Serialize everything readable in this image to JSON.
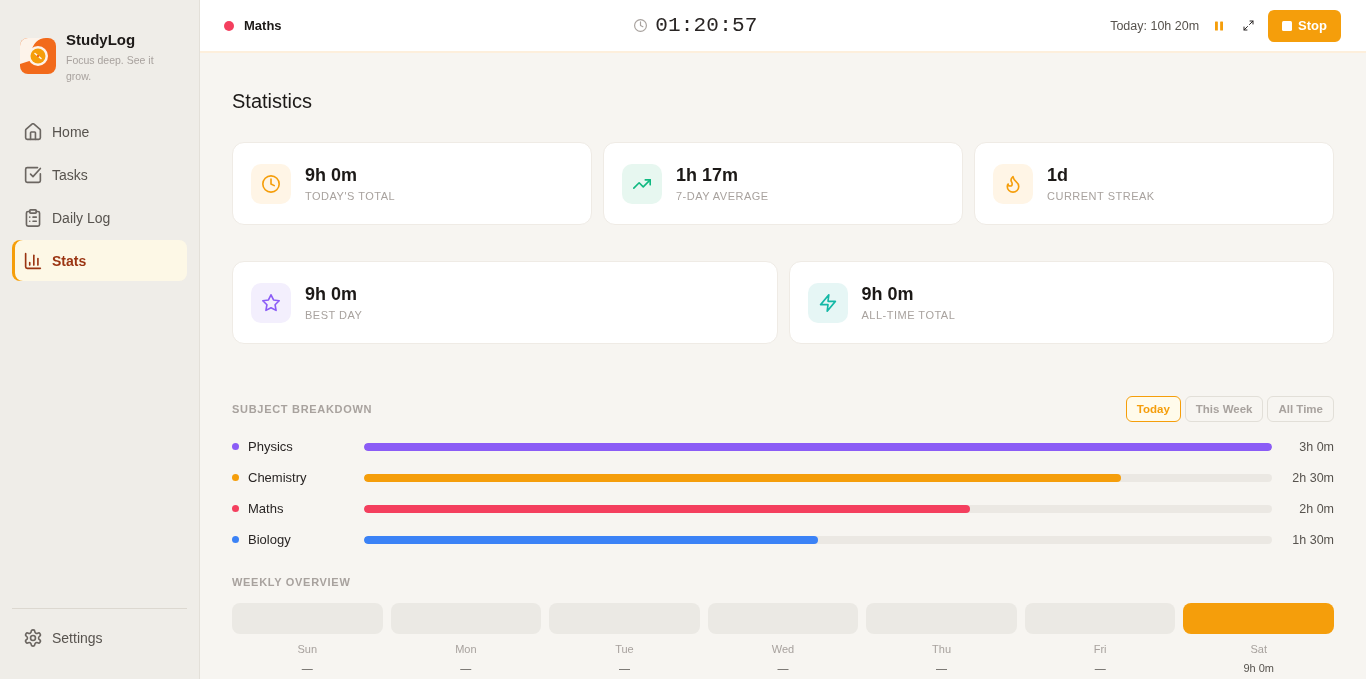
{
  "sidebar": {
    "brand": {
      "name": "StudyLog",
      "tagline": "Focus deep. See it grow."
    },
    "nav": [
      {
        "label": "Home",
        "kind": "home",
        "selected": false
      },
      {
        "label": "Tasks",
        "kind": "tasks",
        "selected": false
      },
      {
        "label": "Daily Log",
        "kind": "log",
        "selected": false
      },
      {
        "label": "Stats",
        "kind": "stats",
        "selected": true
      }
    ],
    "footer_nav": [
      {
        "label": "Settings",
        "kind": "settings",
        "selected": false
      }
    ]
  },
  "top_bar": {
    "subject": {
      "name": "Maths",
      "color": "#f43f5e"
    },
    "timer": "01:20:57",
    "today_total": "Today: 10h 20m",
    "controls": [
      {
        "kind": "pause"
      },
      {
        "kind": "expand"
      },
      {
        "kind": "stop",
        "label": "Stop"
      }
    ]
  },
  "page": {
    "title": "Statistics"
  },
  "stat_rows": [
    {
      "cards": [
        {
          "kind": "today",
          "value": "9h 0m",
          "label": "TODAY'S TOTAL"
        },
        {
          "kind": "average",
          "value": "1h 17m",
          "label": "7-DAY AVERAGE"
        },
        {
          "kind": "streak",
          "value": "1d",
          "label": "CURRENT STREAK"
        }
      ]
    },
    {
      "cards": [
        {
          "kind": "best",
          "value": "9h 0m",
          "label": "BEST DAY"
        },
        {
          "kind": "total",
          "value": "9h 0m",
          "label": "ALL-TIME TOTAL"
        }
      ]
    }
  ],
  "subject_breakdown": {
    "title": "SUBJECT BREAKDOWN",
    "periods": [
      {
        "label": "Today",
        "selected": true
      },
      {
        "label": "This Week",
        "selected": false
      },
      {
        "label": "All Time",
        "selected": false
      }
    ],
    "subjects": [
      {
        "name": "Physics",
        "color": "#8b5cf6",
        "level": 1,
        "time": "3h 0m"
      },
      {
        "name": "Chemistry",
        "color": "#f59e0b",
        "level": 0.834,
        "time": "2h 30m"
      },
      {
        "name": "Maths",
        "color": "#f43f5e",
        "level": 0.667,
        "time": "2h 0m"
      },
      {
        "name": "Biology",
        "color": "#3b82f6",
        "level": 0.5,
        "time": "1h 30m"
      }
    ]
  },
  "weekly_overview": {
    "title": "WEEKLY OVERVIEW",
    "days": [
      {
        "label": "Sun",
        "highlighted": false,
        "time": "—"
      },
      {
        "label": "Mon",
        "highlighted": false,
        "time": "—"
      },
      {
        "label": "Tue",
        "highlighted": false,
        "time": "—"
      },
      {
        "label": "Wed",
        "highlighted": false,
        "time": "—"
      },
      {
        "label": "Thu",
        "highlighted": false,
        "time": "—"
      },
      {
        "label": "Fri",
        "highlighted": false,
        "time": "—"
      },
      {
        "label": "Sat",
        "highlighted": true,
        "time": "9h 0m"
      }
    ]
  }
}
